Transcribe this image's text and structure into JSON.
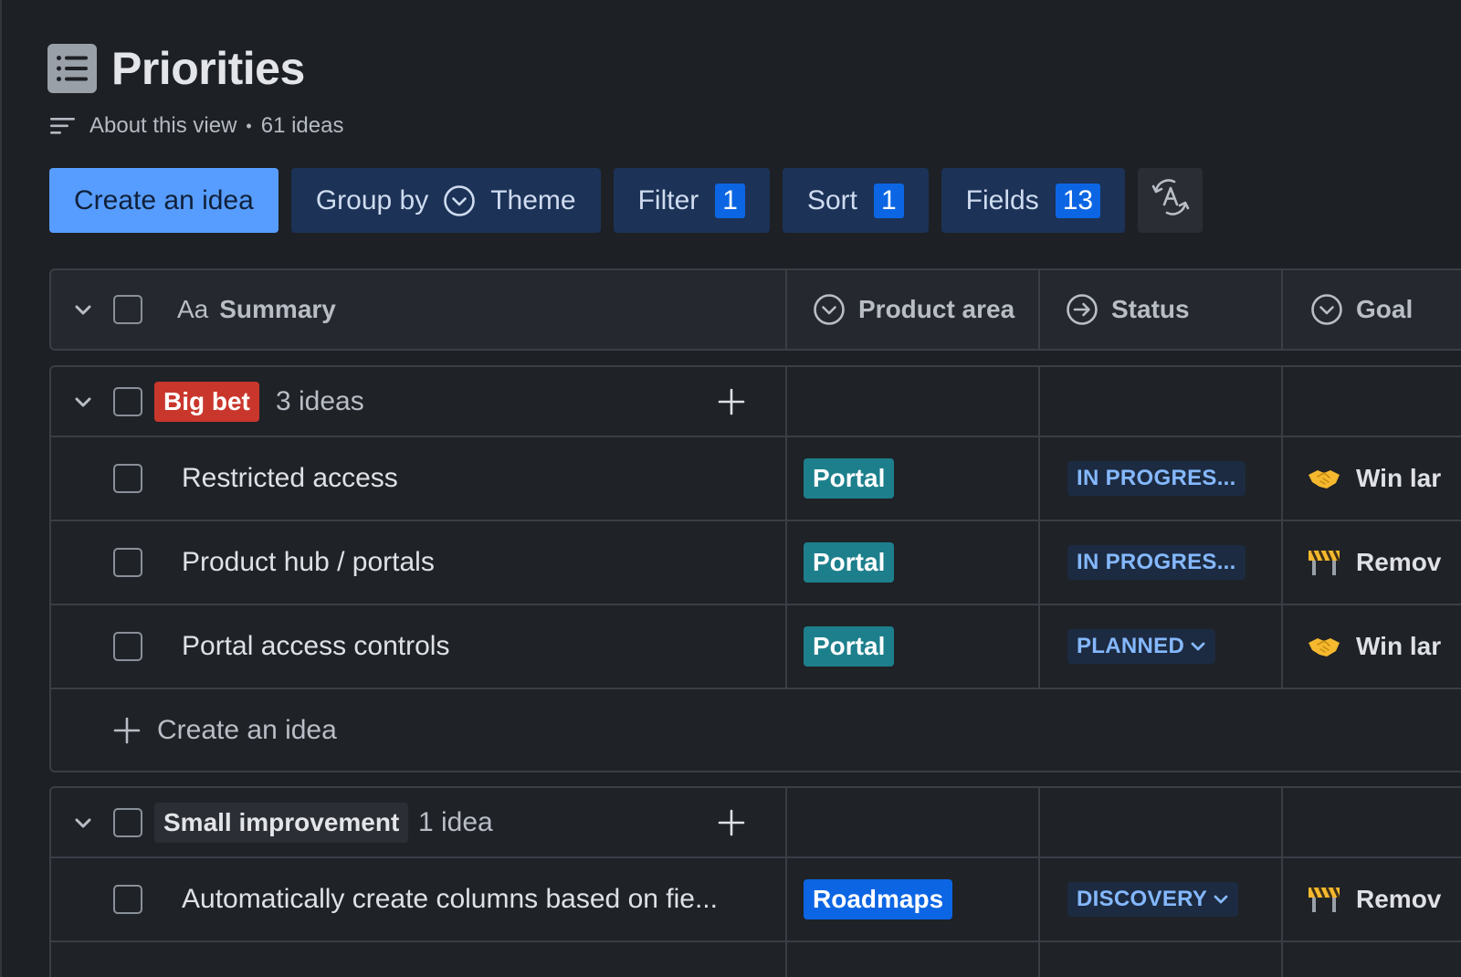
{
  "header": {
    "title": "Priorities",
    "about_label": "About this view",
    "separator": "•",
    "ideas_count": "61 ideas"
  },
  "toolbar": {
    "create_label": "Create an idea",
    "group_by_label": "Group by",
    "group_by_value": "Theme",
    "filter_label": "Filter",
    "filter_count": "1",
    "sort_label": "Sort",
    "sort_count": "1",
    "fields_label": "Fields",
    "fields_count": "13"
  },
  "columns": {
    "summary_prefix": "Aa",
    "summary": "Summary",
    "product_area": "Product area",
    "status": "Status",
    "goal": "Goal"
  },
  "groups": [
    {
      "name": "Big bet",
      "count": "3 ideas",
      "rows": [
        {
          "summary": "Restricted access",
          "area": "Portal",
          "status": "IN PROGRES...",
          "goal": "Win lar"
        },
        {
          "summary": "Product hub / portals",
          "area": "Portal",
          "status": "IN PROGRES...",
          "goal": "Remov"
        },
        {
          "summary": "Portal access controls",
          "area": "Portal",
          "status": "PLANNED",
          "goal": "Win lar"
        }
      ],
      "add_label": "Create an idea"
    },
    {
      "name": "Small improvement",
      "count": "1 idea",
      "rows": [
        {
          "summary": "Automatically create columns based on fie...",
          "area": "Roadmaps",
          "status": "DISCOVERY",
          "goal": "Remov"
        }
      ]
    }
  ],
  "colors": {
    "primary": "#579dff",
    "big_bet": "#c9372c",
    "portal": "#1d7f8c",
    "roadmaps": "#0c66e4",
    "status_text": "#85b8ff"
  }
}
